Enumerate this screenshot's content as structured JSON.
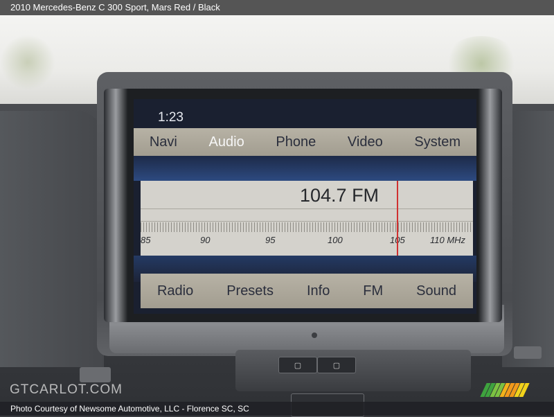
{
  "caption": {
    "title": "2010 Mercedes-Benz C 300 Sport,  Mars Red / Black"
  },
  "screen": {
    "clock": "1:23",
    "menu": [
      "Navi",
      "Audio",
      "Phone",
      "Video",
      "System"
    ],
    "active_menu": "Audio",
    "frequency": "104.7 FM",
    "scale_labels": [
      "85",
      "90",
      "95",
      "100",
      "105",
      "110 MHz"
    ],
    "tuned_value_mhz": 104.7,
    "softkeys": [
      "Radio",
      "Presets",
      "Info",
      "FM",
      "Sound"
    ]
  },
  "footer": {
    "watermark": "GTCARLOT.COM",
    "credit": "Photo Courtesy of Newsome Automotive, LLC - Florence SC, SC"
  },
  "colors": {
    "menu_bar": "#b7b2a5",
    "screen_blue": "#2d4a80",
    "tuner_needle": "#d03030",
    "logo_stripes": [
      "#3ea33e",
      "#7cc242",
      "#f2b21b",
      "#f29a1b",
      "#f2d21b"
    ]
  }
}
